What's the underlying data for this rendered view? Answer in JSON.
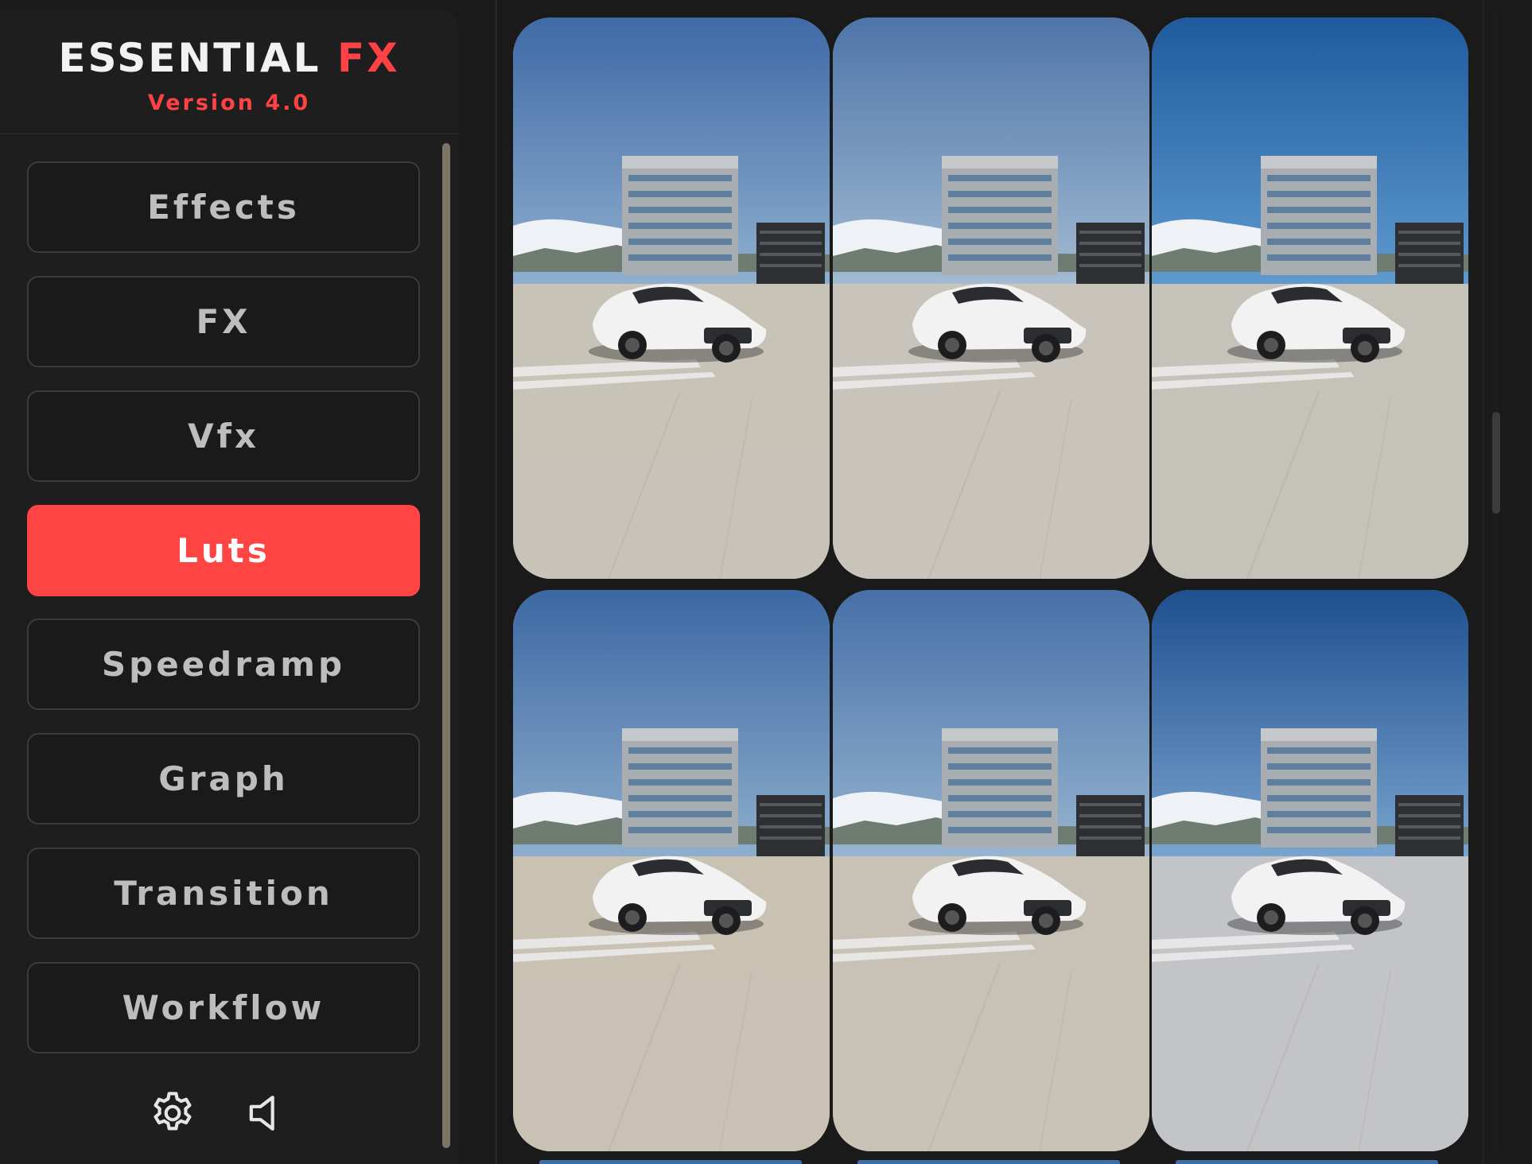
{
  "brand": {
    "title_main": "ESSENTIAL",
    "title_accent": "FX",
    "version": "Version 4.0",
    "accent_color": "#ff4245"
  },
  "nav": {
    "items": [
      {
        "label": "Effects",
        "active": false
      },
      {
        "label": "FX",
        "active": false
      },
      {
        "label": "Vfx",
        "active": false
      },
      {
        "label": "Luts",
        "active": true
      },
      {
        "label": "Speedramp",
        "active": false
      },
      {
        "label": "Graph",
        "active": false
      },
      {
        "label": "Transition",
        "active": false
      },
      {
        "label": "Workflow",
        "active": false
      }
    ],
    "active_color": "#ff4444"
  },
  "footer_icons": {
    "settings": "gear-icon",
    "sound": "speaker-icon"
  },
  "luts": {
    "items": [
      {
        "variant": "neutral",
        "sky_top": "#3f6aa6",
        "sky_bottom": "#8fb0cf",
        "ground": "#c8c3b7"
      },
      {
        "variant": "faded",
        "sky_top": "#4e74a8",
        "sky_bottom": "#a3bcd3",
        "ground": "#c9c4bb"
      },
      {
        "variant": "cool-vivid",
        "sky_top": "#1f5a9e",
        "sky_bottom": "#5f9bd0",
        "ground": "#c5c2ba"
      },
      {
        "variant": "warm",
        "sky_top": "#3c68a3",
        "sky_bottom": "#8eafcd",
        "ground": "#c9c2b3"
      },
      {
        "variant": "soft",
        "sky_top": "#4670a8",
        "sky_bottom": "#98b5d1",
        "ground": "#c8c2b6"
      },
      {
        "variant": "cool",
        "sky_top": "#1e4f8f",
        "sky_bottom": "#7aa5cf",
        "ground": "#c2c4c8"
      }
    ]
  }
}
